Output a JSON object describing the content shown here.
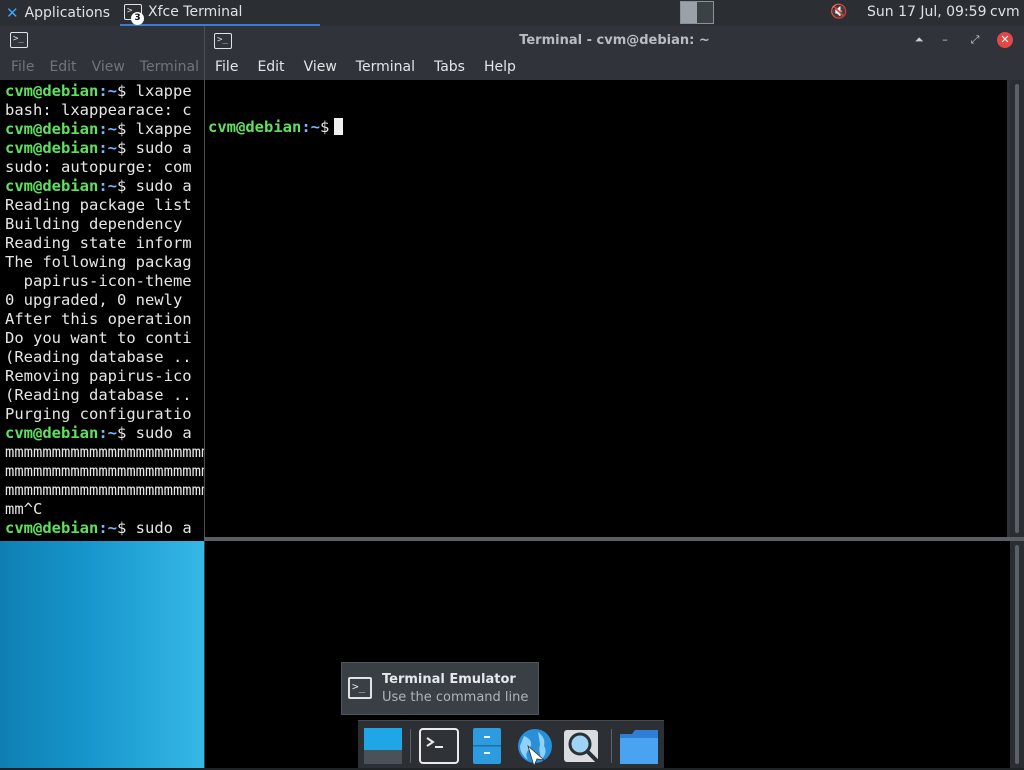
{
  "panel": {
    "applications_label": "Applications",
    "task_title": "Xfce Terminal",
    "task_badge": "3",
    "clock": "Sun 17 Jul, 09:59",
    "user": "cvm"
  },
  "back_window": {
    "menu": [
      "File",
      "Edit",
      "View",
      "Terminal"
    ],
    "lines": [
      {
        "user": "cvm@debian",
        "path": ":~",
        "rest": "$ lxappe"
      },
      {
        "text": "bash: lxappearace: c"
      },
      {
        "user": "cvm@debian",
        "path": ":~",
        "rest": "$ lxappe"
      },
      {
        "user": "cvm@debian",
        "path": ":~",
        "rest": "$ sudo a"
      },
      {
        "text": "sudo: autopurge: com"
      },
      {
        "user": "cvm@debian",
        "path": ":~",
        "rest": "$ sudo a"
      },
      {
        "text": "Reading package list"
      },
      {
        "text": "Building dependency "
      },
      {
        "text": "Reading state inform"
      },
      {
        "text": "The following packag"
      },
      {
        "text": "  papirus-icon-theme"
      },
      {
        "text": "0 upgraded, 0 newly "
      },
      {
        "text": "After this operation"
      },
      {
        "text": "Do you want to conti"
      },
      {
        "text": "(Reading database .."
      },
      {
        "text": "Removing papirus-ico"
      },
      {
        "text": "(Reading database .."
      },
      {
        "text": "Purging configuratio"
      },
      {
        "user": "cvm@debian",
        "path": ":~",
        "rest": "$ sudo a"
      },
      {
        "text": "mmmmmmmmmmmmmmmmmmmmmm"
      },
      {
        "text": "mmmmmmmmmmmmmmmmmmmmmm"
      },
      {
        "text": "mmmmmmmmmmmmmmmmmmmmmm"
      },
      {
        "text": "mm^C"
      },
      {
        "user": "cvm@debian",
        "path": ":~",
        "rest": "$ sudo a"
      }
    ]
  },
  "front_window": {
    "title": "Terminal - cvm@debian: ~",
    "menu": [
      "File",
      "Edit",
      "View",
      "Terminal",
      "Tabs",
      "Help"
    ],
    "prompt_user": "cvm@debian",
    "prompt_path": ":~",
    "prompt_symbol": "$"
  },
  "tooltip": {
    "title": "Terminal Emulator",
    "subtitle": "Use the command line"
  },
  "dock": {
    "items": [
      "show-desktop",
      "terminal-emulator",
      "file-manager",
      "web-browser",
      "app-finder",
      "home-folder"
    ]
  },
  "colors": {
    "prompt_user": "#5fe05f",
    "prompt_path": "#7db5ff",
    "panel": "#2b2f33",
    "close_button": "#e24848"
  }
}
